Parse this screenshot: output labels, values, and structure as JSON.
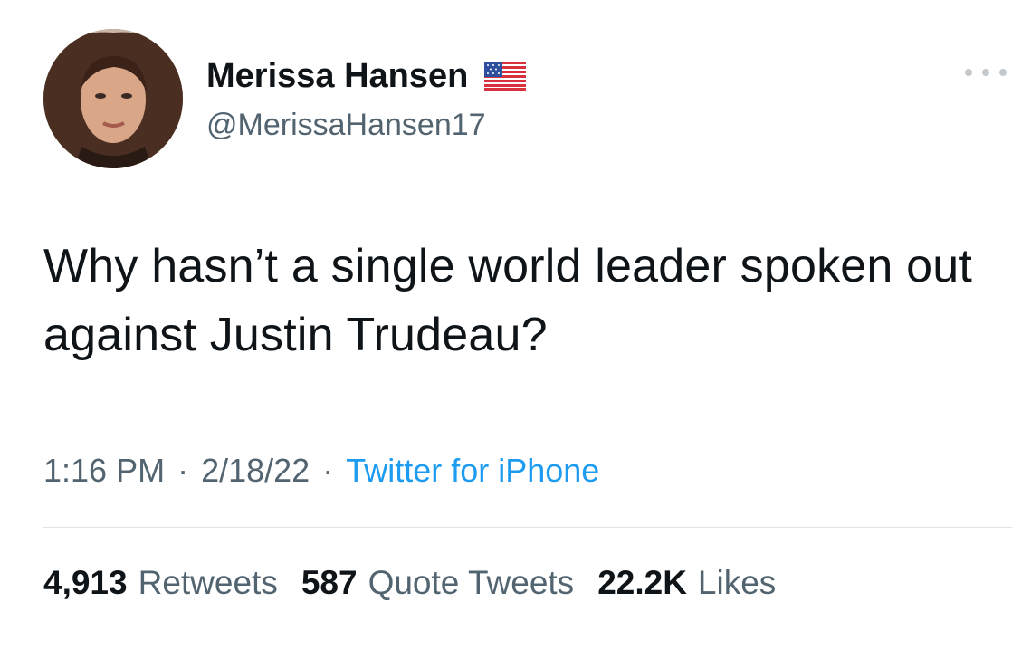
{
  "tweet": {
    "author": {
      "name": "Merissa Hansen",
      "handle": "@MerissaHansen17",
      "badge_icon": "us-flag-icon"
    },
    "text": "Why hasn’t a single world leader spoken out against Justin Trudeau?",
    "time": "1:16 PM",
    "date": "2/18/22",
    "separator": "·",
    "source": "Twitter for iPhone",
    "more_icon": "more-options-icon",
    "stats": {
      "retweets": {
        "count": "4,913",
        "label": "Retweets"
      },
      "quotes": {
        "count": "587",
        "label": "Quote Tweets"
      },
      "likes": {
        "count": "22.2K",
        "label": "Likes"
      }
    }
  },
  "colors": {
    "text_primary": "#0f1419",
    "text_secondary": "#536471",
    "link": "#1d9bf0",
    "divider": "#dde3e7"
  }
}
